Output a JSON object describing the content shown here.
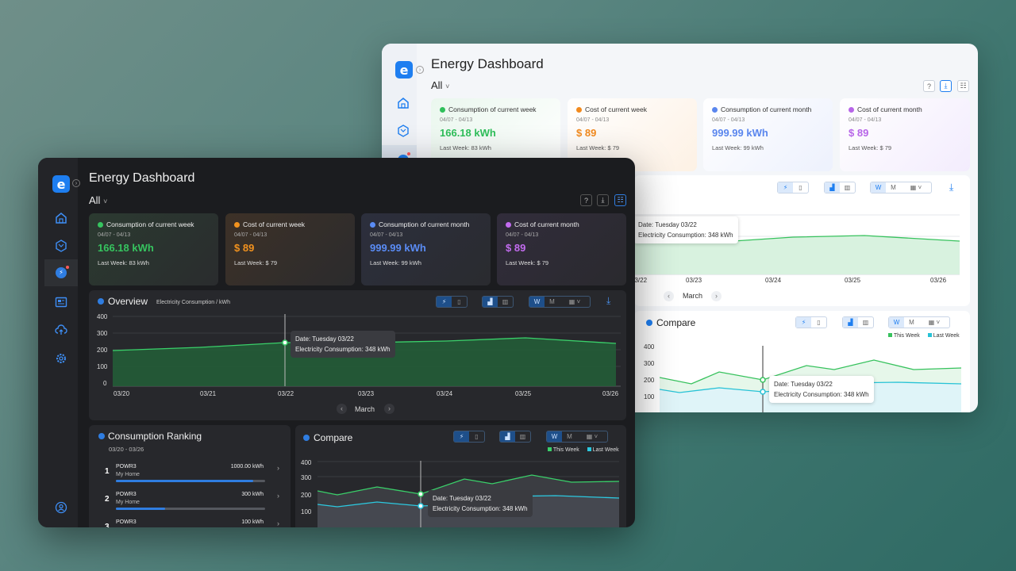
{
  "light": {
    "title": "Energy Dashboard",
    "filter": "All",
    "cards": [
      {
        "title": "Consumption of current week",
        "date": "04/07 - 04/13",
        "value": "166.18  kWh",
        "last": "Last Week:  83 kWh",
        "color": "#2fbf5a"
      },
      {
        "title": "Cost of current week",
        "date": "04/07 - 04/13",
        "value": "$  89",
        "last": "Last Week:  $ 79",
        "color": "#f28a1e"
      },
      {
        "title": "Consumption of current month",
        "date": "04/07 - 04/13",
        "value": "999.99  kWh",
        "last": "Last Week:  99 kWh",
        "color": "#5a86ee"
      },
      {
        "title": "Cost of current month",
        "date": "04/07 - 04/13",
        "value": "$  89",
        "last": "Last Week:  $ 79",
        "color": "#b765e8"
      }
    ],
    "overview": {
      "tooltip_date": "Date:  Tuesday 03/22",
      "tooltip_value": "Electricity Consumption:  348 kWh",
      "x_labels": [
        "03/22",
        "03/23",
        "03/24",
        "03/25",
        "03/26"
      ],
      "month": "March"
    },
    "compare": {
      "title": "Compare",
      "legend_this": "This Week",
      "legend_last": "Last Week",
      "y_labels": [
        "400",
        "300",
        "200",
        "100"
      ],
      "tooltip_date": "Date:  Tuesday 03/22",
      "tooltip_value": "Electricity Consumption:  348 kWh"
    },
    "seg_labels": {
      "w": "W",
      "m": "M"
    }
  },
  "dark": {
    "title": "Energy Dashboard",
    "filter": "All",
    "cards": [
      {
        "title": "Consumption of current week",
        "date": "04/07 - 04/13",
        "value": "166.18  kWh",
        "last": "Last Week:  83 kWh",
        "color": "#36c45f"
      },
      {
        "title": "Cost of current week",
        "date": "04/07 - 04/13",
        "value": "$  89",
        "last": "Last Week:  $ 79",
        "color": "#f2921e"
      },
      {
        "title": "Consumption of current month",
        "date": "04/07 - 04/13",
        "value": "999.99  kWh",
        "last": "Last Week:  99 kWh",
        "color": "#5a8cf5"
      },
      {
        "title": "Cost of current month",
        "date": "04/07 - 04/13",
        "value": "$  89",
        "last": "Last Week:  $ 79",
        "color": "#c36cf0"
      }
    ],
    "overview": {
      "title": "Overview",
      "subtitle": "Electricity Consumption / kWh",
      "y_labels": [
        "400",
        "300",
        "200",
        "100",
        "0"
      ],
      "x_labels": [
        "03/20",
        "03/21",
        "03/22",
        "03/23",
        "03/24",
        "03/25",
        "03/26"
      ],
      "tooltip_date": "Date:  Tuesday 03/22",
      "tooltip_value": "Electricity Consumption:  348 kWh",
      "month": "March"
    },
    "ranking": {
      "title": "Consumption Ranking",
      "range": "03/20 - 03/26",
      "items": [
        {
          "rank": "1",
          "name": "POWR3",
          "home": "My Home",
          "value": "1000.00 kWh",
          "pct": 0.92
        },
        {
          "rank": "2",
          "name": "POWR3",
          "home": "My Home",
          "value": "300 kWh",
          "pct": 0.33
        },
        {
          "rank": "3",
          "name": "POWR3",
          "home": "",
          "value": "100 kWh",
          "pct": 0.1
        }
      ]
    },
    "compare": {
      "title": "Compare",
      "legend_this": "This Week",
      "legend_last": "Last Week",
      "y_labels": [
        "400",
        "300",
        "200",
        "100"
      ],
      "tooltip_date": "Date:  Tuesday 03/22",
      "tooltip_value": "Electricity Consumption:  348 kWh"
    },
    "seg_labels": {
      "w": "W",
      "m": "M"
    }
  },
  "icons": {
    "logo": "e",
    "expand": "chevron-right-icon",
    "help": "?",
    "download": "download-icon",
    "report": "report-icon",
    "bolt": "⚡",
    "chevron_left": "‹",
    "chevron_right": "›",
    "caret": "˅"
  }
}
